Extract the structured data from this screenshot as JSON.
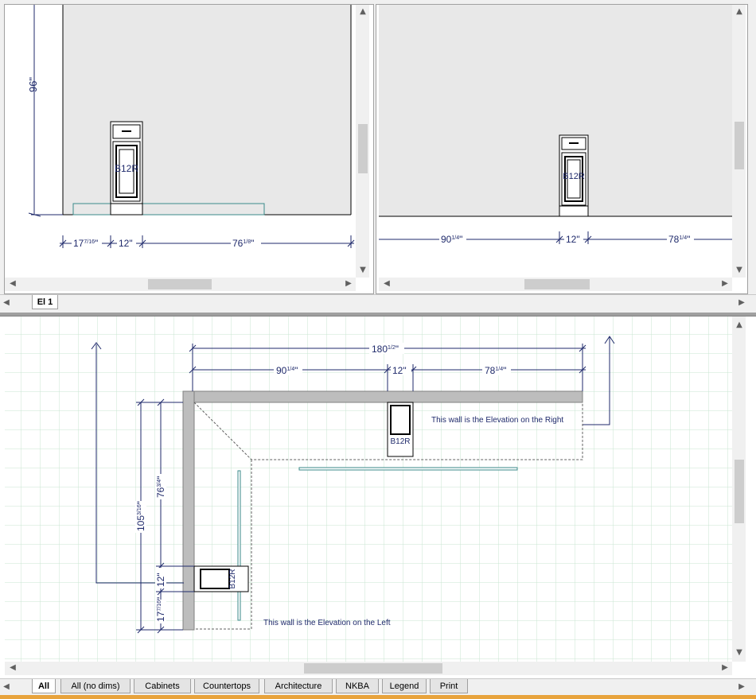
{
  "top_left_view": {
    "height_dim": "96\"",
    "cabinet_label": "B12R",
    "dim_left": "17",
    "dim_left_frac": "7/16",
    "dim_mid": "12\"",
    "dim_right": "76",
    "dim_right_frac": "1/8"
  },
  "top_right_view": {
    "cabinet_label": "B12R",
    "dim_left": "90",
    "dim_left_frac": "1/4",
    "dim_mid": "12\"",
    "dim_right": "78",
    "dim_right_frac": "1/4"
  },
  "elevation_tabs": [
    {
      "label": "El 1",
      "active": true
    }
  ],
  "plan_view": {
    "overall_dim": "180",
    "overall_dim_frac": "1/2",
    "dim_left": "90",
    "dim_left_frac": "1/4",
    "dim_mid": "12\"",
    "dim_right": "78",
    "dim_right_frac": "1/4",
    "vertical_overall": "105",
    "vertical_overall_frac": "3/16",
    "vertical_top": "76",
    "vertical_top_frac": "3/4",
    "vertical_mid": "12\"",
    "vertical_bottom": "17",
    "vertical_bottom_frac": "7/16",
    "cabinet_top_label": "B12R",
    "cabinet_left_label": "B12R",
    "note_right": "This wall is the Elevation on the Right",
    "note_left": "This wall is the Elevation on the Left"
  },
  "bottom_tabs": [
    {
      "label": "All",
      "active": true
    },
    {
      "label": "All (no dims)",
      "active": false
    },
    {
      "label": "Cabinets",
      "active": false
    },
    {
      "label": "Countertops",
      "active": false
    },
    {
      "label": "Architecture",
      "active": false
    },
    {
      "label": "NKBA",
      "active": false
    },
    {
      "label": "Legend",
      "active": false
    },
    {
      "label": "Print",
      "active": false
    }
  ],
  "colors": {
    "dim_line": "#1f2a6b",
    "grid": "#c8e6d2",
    "wall": "#bdbdbd",
    "counter": "#3a8a8a",
    "elev_bg": "#e8e8e8",
    "accent_bar": "#e8a33c"
  },
  "icons": {
    "scroll_up": "▲",
    "scroll_down": "▼",
    "scroll_left": "◀",
    "scroll_right": "▶"
  }
}
